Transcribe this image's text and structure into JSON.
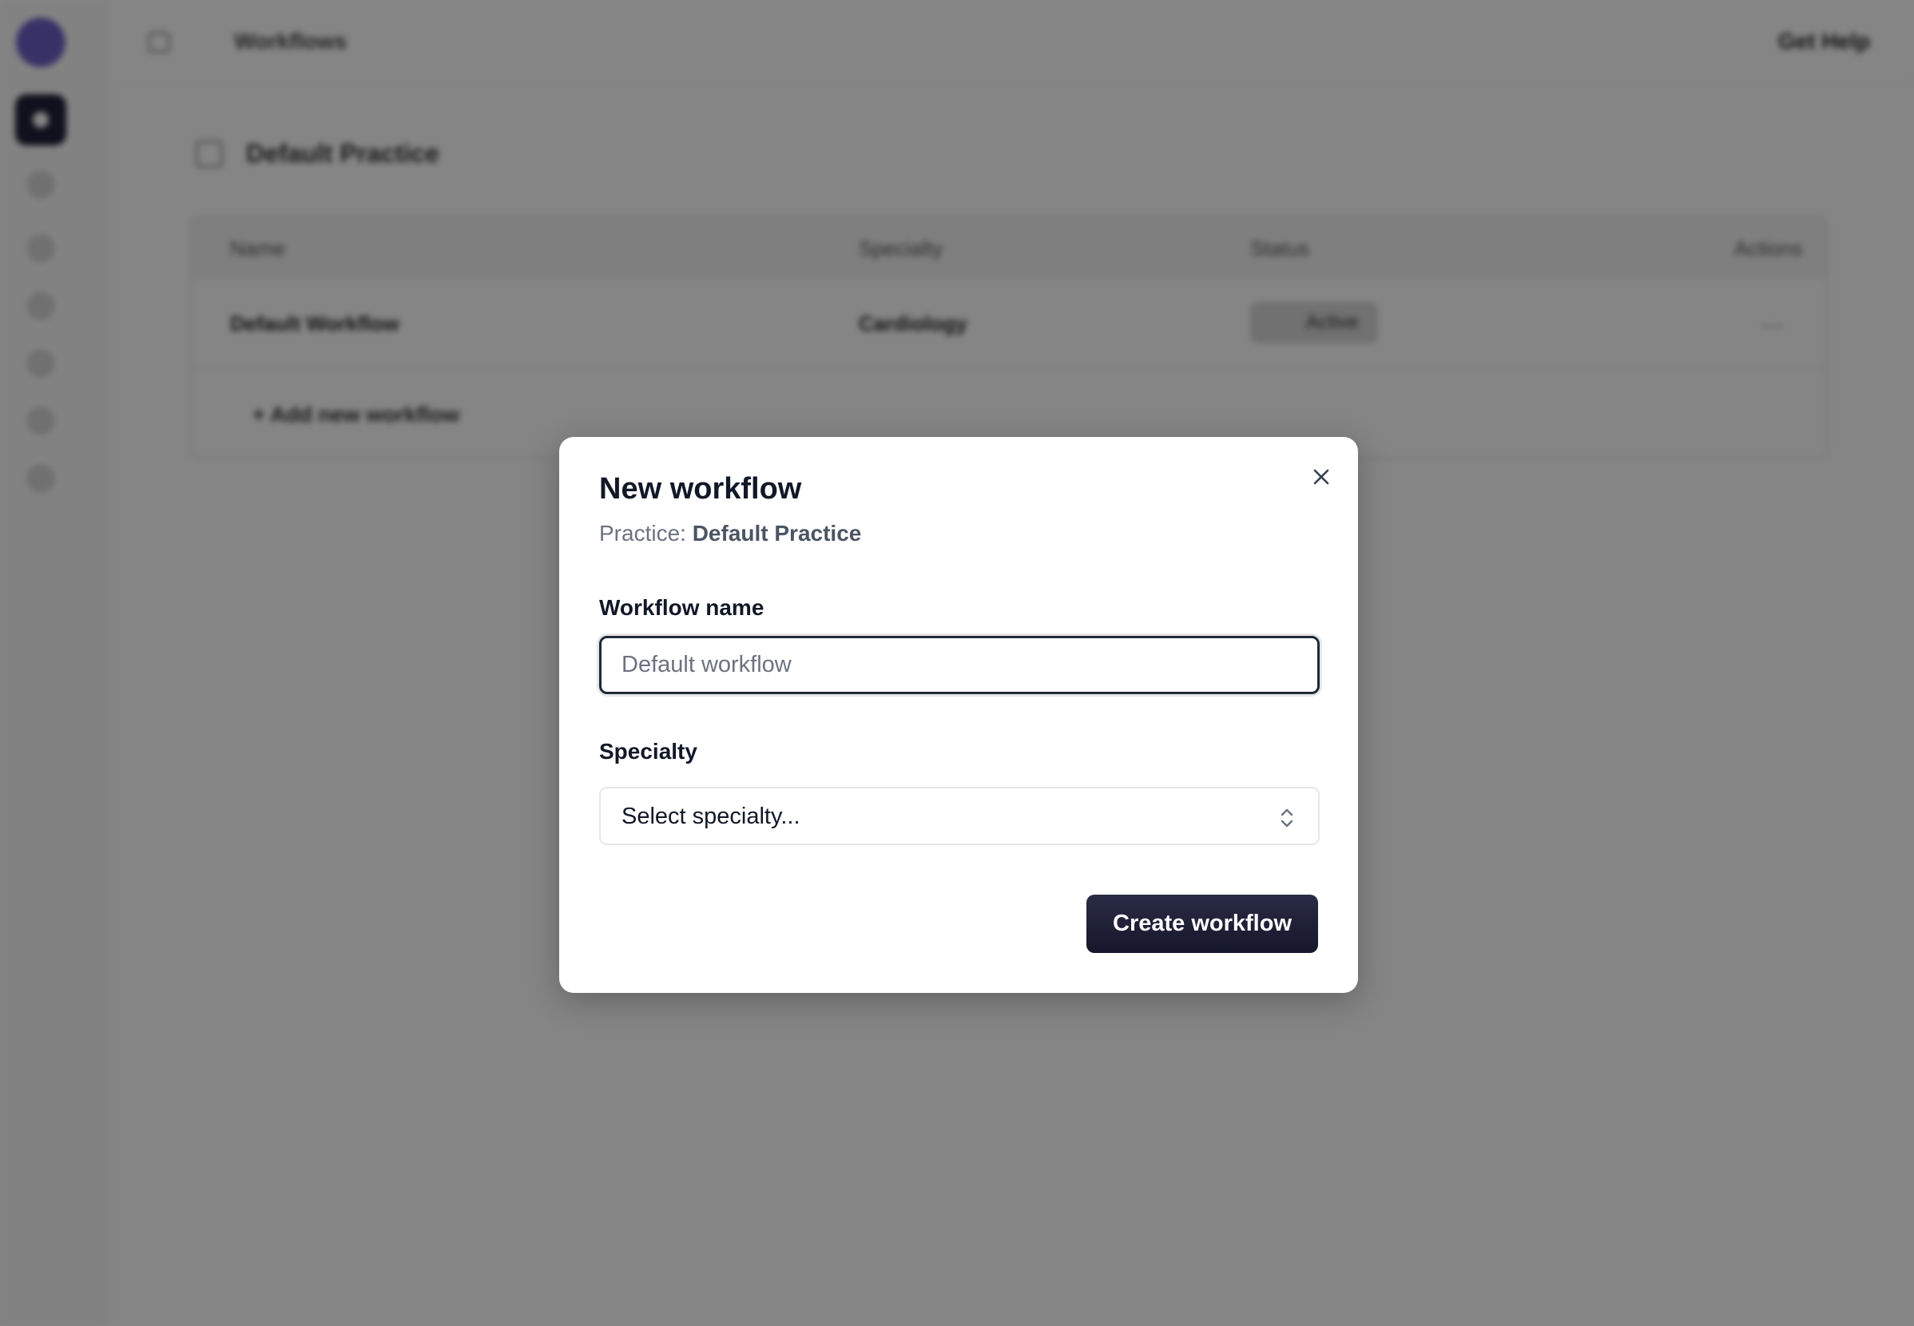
{
  "topbar": {
    "breadcrumb": "Workflows",
    "help_label": "Get Help"
  },
  "page": {
    "title": "Default Practice"
  },
  "table": {
    "columns": [
      "Name",
      "Specialty",
      "Status",
      "Actions"
    ],
    "rows": [
      {
        "name": "Default Workflow",
        "specialty": "Cardiology",
        "status": "Active",
        "actions": "…"
      }
    ],
    "add_label": "+  Add new workflow"
  },
  "modal": {
    "title": "New workflow",
    "practice_prefix": "Practice: ",
    "practice_name": "Default Practice",
    "workflow_name_label": "Workflow name",
    "workflow_name_value": "",
    "workflow_name_placeholder": "Default workflow",
    "specialty_label": "Specialty",
    "specialty_value": "Select specialty...",
    "submit_label": "Create workflow"
  },
  "colors": {
    "primary_button": "#1b1c30",
    "overlay": "rgba(0,0,0,0.48)",
    "brand": "#6c5fc7"
  }
}
